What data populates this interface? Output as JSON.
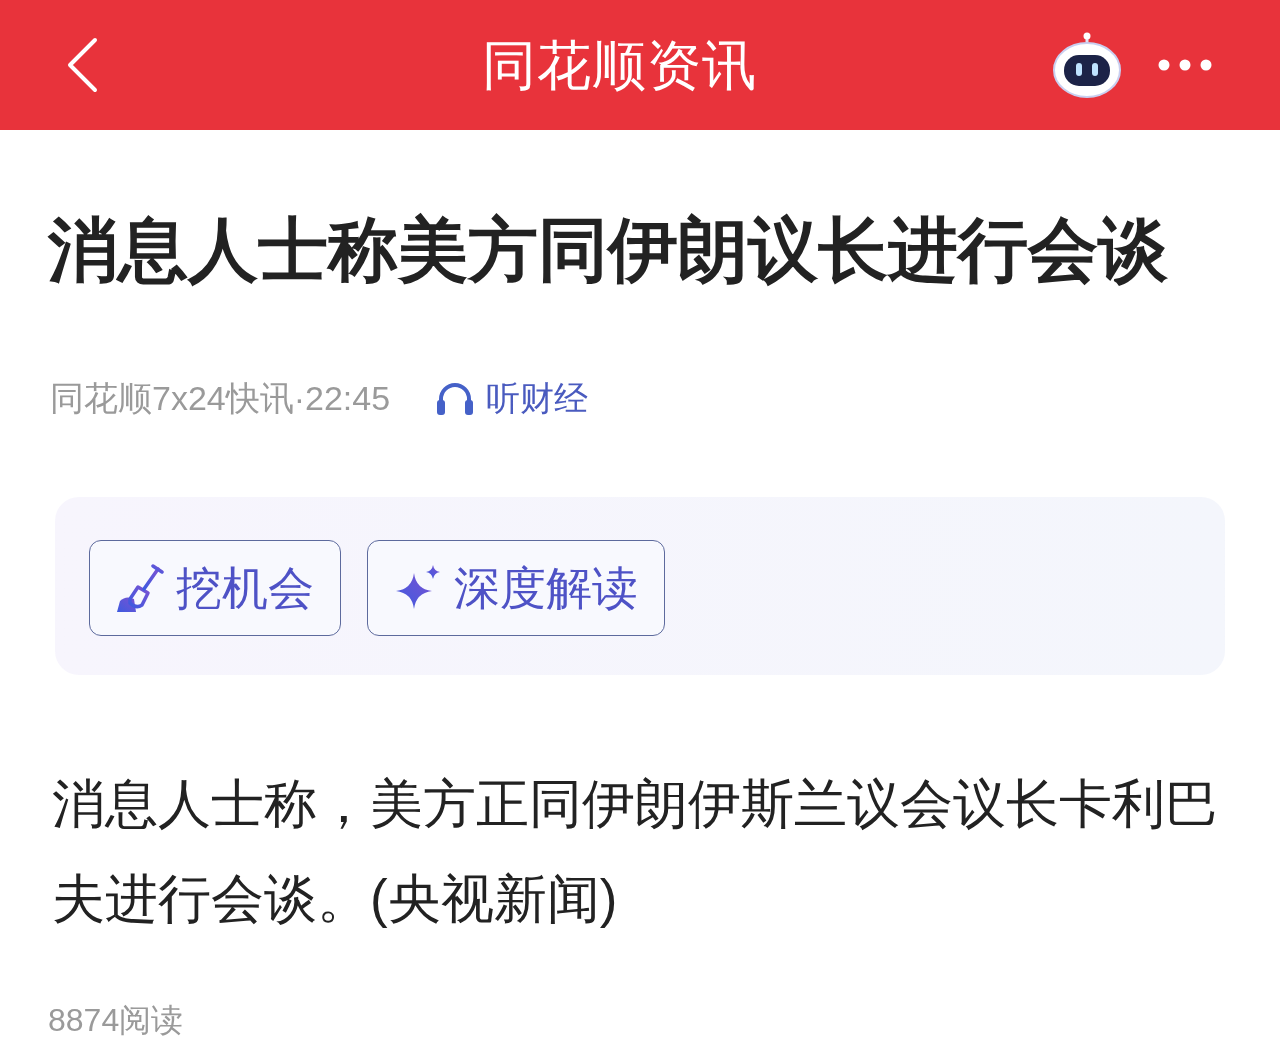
{
  "header": {
    "title": "同花顺资讯"
  },
  "article": {
    "headline": "消息人士称美方同伊朗议长进行会谈",
    "meta": "同花顺7x24快讯·22:45",
    "listen_label": "听财经"
  },
  "actions": [
    {
      "kind": "dig",
      "label": "挖机会"
    },
    {
      "kind": "insight",
      "label": "深度解读"
    }
  ],
  "body": "消息人士称，美方正同伊朗伊斯兰议会议长卡利巴夫进行会谈。(央视新闻)",
  "read_count": "8874阅读"
}
